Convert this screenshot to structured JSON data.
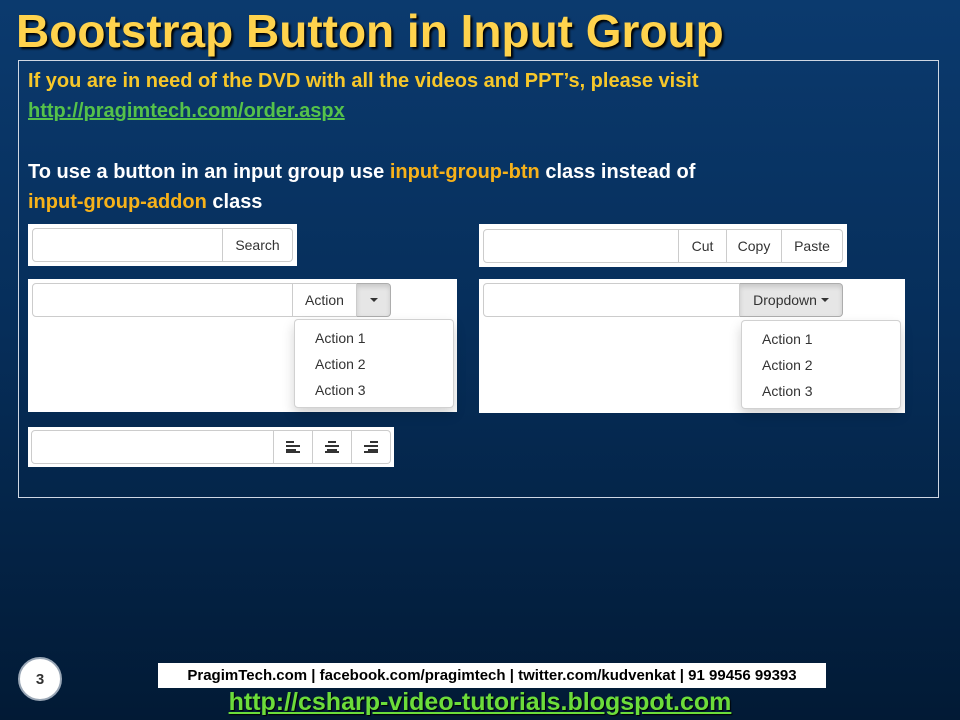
{
  "slide": {
    "title": "Bootstrap Button in Input Group",
    "intro_text": "If you are in need of the DVD with all the videos and PPT’s, please visit",
    "intro_link": "http://pragimtech.com/order.aspx",
    "desc_prefix": "To use a button in an input group use ",
    "desc_highlight1": "input-group-btn",
    "desc_middle": " class instead of",
    "desc_highlight2": "input-group-addon",
    "desc_suffix": " class"
  },
  "demos": {
    "search_group": {
      "input_value": "",
      "button_label": "Search"
    },
    "clipboard_group": {
      "input_value": "",
      "buttons": [
        "Cut",
        "Copy",
        "Paste"
      ]
    },
    "split_dropdown_group": {
      "input_value": "",
      "button_label": "Action",
      "toggle_icon": "caret-down-icon",
      "menu_items": [
        "Action 1",
        "Action 2",
        "Action 3"
      ]
    },
    "dropdown_group": {
      "input_value": "",
      "button_label": "Dropdown",
      "menu_items": [
        "Action 1",
        "Action 2",
        "Action 3"
      ]
    },
    "align_group": {
      "input_value": "",
      "icons": [
        "align-left-icon",
        "align-center-icon",
        "align-right-icon"
      ]
    }
  },
  "footer": {
    "contact": "PragimTech.com | facebook.com/pragimtech  | twitter.com/kudvenkat  | 91 99456 99393",
    "link": "http://csharp-video-tutorials.blogspot.com",
    "page_number": "3"
  },
  "colors": {
    "title": "#ffd34d",
    "highlight": "#f7b21a",
    "link": "#55c24a",
    "background": "#062e5a"
  }
}
